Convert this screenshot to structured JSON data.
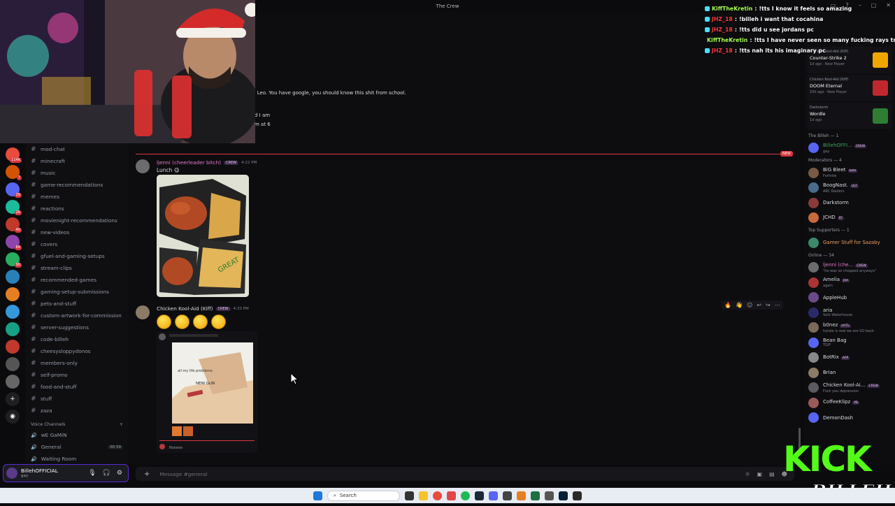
{
  "window": {
    "title": "The Crew",
    "search_placeholder": "Search"
  },
  "channels": {
    "items": [
      "mod-chat",
      "minecraft",
      "music",
      "game-recommendations",
      "memes",
      "reactions",
      "movienight-recommendations",
      "new-videos",
      "covers",
      "gfuel-and-gaming-setups",
      "stream-clips",
      "recommended-games",
      "gaming-setup-submissions",
      "pets-and-stuff",
      "custom-artwork-for-commission",
      "server-suggestions",
      "code-billeh",
      "cheesysloppydonos",
      "members-only",
      "self-promo",
      "food-and-stuff",
      "stuff",
      "zaza"
    ],
    "voice_header": "Voice Channels",
    "voice": [
      {
        "label": "wE GaMiN",
        "count": ""
      },
      {
        "label": "General",
        "count": "00 59"
      },
      {
        "label": "Waiting Room",
        "count": ""
      }
    ]
  },
  "server_badges": [
    "114K",
    "7",
    "29",
    "26",
    "40",
    "64",
    "90"
  ],
  "user_panel": {
    "name": "BillehOFFICIAL",
    "status": "gay"
  },
  "chat": {
    "prev_text": [
      "rs daily Leo. You have google, you should know this shit from school.",
      "d I am",
      "m at 6"
    ],
    "new_tag": "NEW",
    "messages": [
      {
        "author": "ljenni (cheerleader bitch)",
        "tag": "CREW",
        "time": "4:22 PM",
        "text": "Lunch 😋",
        "color": "#e879c8"
      },
      {
        "author": "Chicken Kool-Aid (Kiff)",
        "tag": "CREW",
        "time": "4:33 PM",
        "text": "",
        "color": "#dbdee1"
      }
    ],
    "embed_caption": "all my life problems:",
    "embed_sticker": "NEW GUN",
    "embed_reply": "Nooooo",
    "input_placeholder": "Message #general"
  },
  "members": {
    "activities": [
      {
        "user": "Chicken Kool-Aid (Kiff)",
        "game": "Counter-Strike 2",
        "meta": "1d ago · New Player"
      },
      {
        "user": "Chicken Kool-Aid (Kiff)",
        "game": "DOOM Eternal",
        "meta": "10h ago · New Player"
      },
      {
        "user": "Darkstorm",
        "game": "Wordle",
        "meta": "1d ago"
      }
    ],
    "groups": [
      {
        "title": "The Billeh — 1",
        "list": [
          {
            "name": "BillehOFFI...",
            "status": "gay",
            "color": "#3ba55c",
            "tag": "CREW"
          }
        ]
      },
      {
        "title": "Moderators — 4",
        "list": [
          {
            "name": "BiG Bleet",
            "status": "Fortnite",
            "color": "#dbdee1",
            "tag": "kate"
          },
          {
            "name": "BoogNast.",
            "status": "ARC Raiders",
            "color": "#dbdee1",
            "tag": "ULT"
          },
          {
            "name": "Darkstorm",
            "status": "",
            "color": "#dbdee1",
            "tag": ""
          },
          {
            "name": "JCHD",
            "status": "",
            "color": "#dbdee1",
            "tag": "RT"
          }
        ]
      },
      {
        "title": "Top Supporters — 1",
        "list": [
          {
            "name": "Gamer Stuff for Sazaby",
            "status": "",
            "color": "#f0a05a",
            "tag": ""
          }
        ]
      },
      {
        "title": "Online — 34",
        "list": [
          {
            "name": "ljenni (che...",
            "status": "\"he was so chopped anyways\"",
            "color": "#e879c8",
            "tag": "CREW"
          },
          {
            "name": "Amelia",
            "status": "again",
            "color": "#dbdee1",
            "tag": "Joe"
          },
          {
            "name": "AppleHub",
            "status": "",
            "color": "#dbdee1",
            "tag": ""
          },
          {
            "name": "aria",
            "status": "Solo Waterhouse",
            "color": "#dbdee1",
            "tag": ""
          },
          {
            "name": "b0nez",
            "status": "hytale is real we are SO back",
            "color": "#dbdee1",
            "tag": "HYTL"
          },
          {
            "name": "Bean Bag",
            "status": "TGIF",
            "color": "#dbdee1",
            "tag": ""
          },
          {
            "name": "BotRix",
            "status": "",
            "color": "#dbdee1",
            "tag": "APP"
          },
          {
            "name": "Brian",
            "status": "",
            "color": "#dbdee1",
            "tag": ""
          },
          {
            "name": "Chicken Kool-Ai...",
            "status": "Fuck you depression",
            "color": "#dbdee1",
            "tag": "CREW"
          },
          {
            "name": "CoffeeKlipz",
            "status": "",
            "color": "#dbdee1",
            "tag": "PB"
          },
          {
            "name": "DemonDash",
            "status": "",
            "color": "#dbdee1",
            "tag": ""
          }
        ]
      }
    ]
  },
  "stream_chat": [
    {
      "user": "KiffTheKretin",
      "msg": "!tts I know it feels so amazing",
      "color": "#a6ff4d"
    },
    {
      "user": "JHZ_18",
      "msg": "!billeh i want that cocahina",
      "color": "#ff3b3b"
    },
    {
      "user": "JHZ_18",
      "msg": "!tts did u see jordans pc",
      "color": "#ff3b3b"
    },
    {
      "user": "KiffTheKretin",
      "msg": "!tts I have never seen so many fucking rays traced",
      "color": "#a6ff4d"
    },
    {
      "user": "JHZ_18",
      "msg": "!tts nah its his imaginary pc",
      "color": "#ff3b3b"
    }
  ],
  "kick_logo": {
    "top": "KICK",
    "bottom": "BILLEH"
  },
  "taskbar": {
    "search_label": "Search"
  }
}
